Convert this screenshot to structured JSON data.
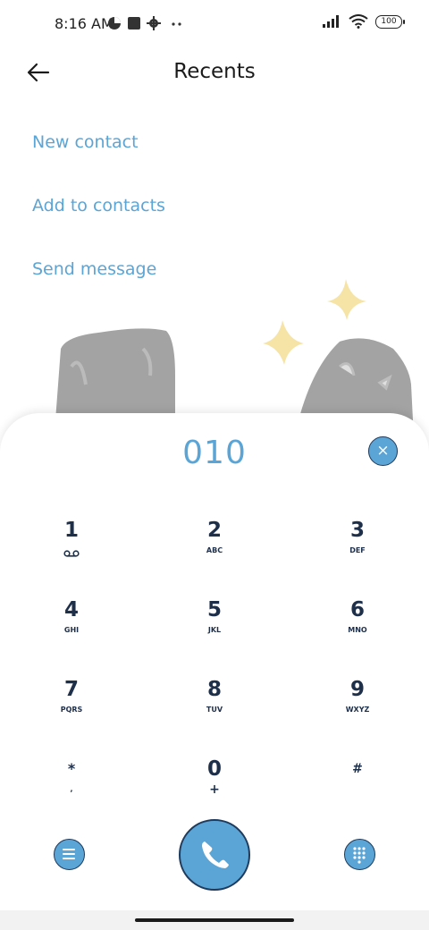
{
  "status_bar": {
    "time": "8:16 AM",
    "battery": "100"
  },
  "header": {
    "title": "Recents"
  },
  "actions": {
    "new_contact": "New contact",
    "add_to_contacts": "Add to contacts",
    "send_message": "Send message"
  },
  "dialer": {
    "number": "010",
    "clear_symbol": "×",
    "keys": [
      {
        "digit": "1",
        "letters": ""
      },
      {
        "digit": "2",
        "letters": "ABC"
      },
      {
        "digit": "3",
        "letters": "DEF"
      },
      {
        "digit": "4",
        "letters": "GHI"
      },
      {
        "digit": "5",
        "letters": "JKL"
      },
      {
        "digit": "6",
        "letters": "MNO"
      },
      {
        "digit": "7",
        "letters": "PQRS"
      },
      {
        "digit": "8",
        "letters": "TUV"
      },
      {
        "digit": "9",
        "letters": "WXYZ"
      },
      {
        "digit": "*",
        "letters": ","
      },
      {
        "digit": "0",
        "letters": "+"
      },
      {
        "digit": "#",
        "letters": ""
      }
    ]
  },
  "icons": {
    "back": "back-arrow-icon",
    "call": "phone-icon",
    "menu": "menu-icon",
    "keypad": "keypad-grid-icon",
    "voicemail": "voicemail-icon",
    "wifi": "wifi-icon",
    "signal": "signal-icon"
  },
  "colors": {
    "accent": "#5ba5d6",
    "key_text": "#1e2f4a",
    "sparkle": "#f6e3a6"
  }
}
